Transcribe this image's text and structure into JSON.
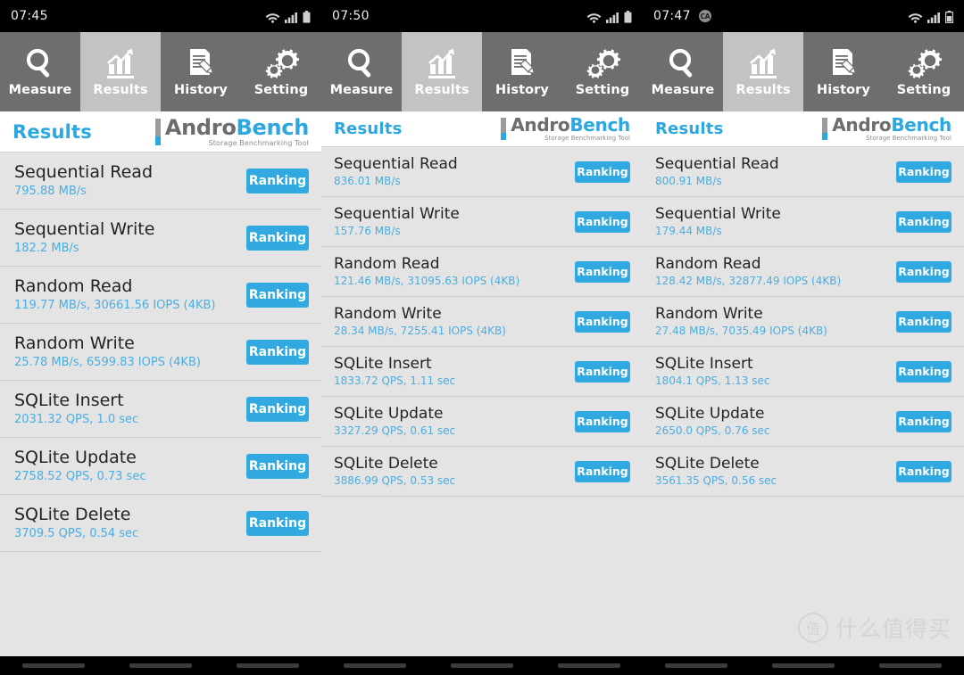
{
  "app": {
    "name": "AndroBench",
    "logo": {
      "part_a": "Andro",
      "part_b": "Bench",
      "tagline": "Storage Benchmarking Tool"
    },
    "header_title": "Results",
    "accent_color": "#30a9e0",
    "tabbar_color": "#6e6e6e",
    "tab_active_color": "#c3c3c3",
    "value_color": "#4aaee2"
  },
  "tabs": [
    {
      "id": "measure",
      "label": "Measure",
      "icon": "magnifier-icon",
      "active": false
    },
    {
      "id": "results",
      "label": "Results",
      "icon": "bar-chart-icon",
      "active": true
    },
    {
      "id": "history",
      "label": "History",
      "icon": "document-pencil-icon",
      "active": false
    },
    {
      "id": "setting",
      "label": "Setting",
      "icon": "gears-icon",
      "active": false
    }
  ],
  "ranking_label": "Ranking",
  "watermark": {
    "badge": "值",
    "text": "什么值得买"
  },
  "panels": [
    {
      "id": "panel-1",
      "status": {
        "time": "07:45",
        "badge": "",
        "icons": [
          "wifi-icon",
          "signal-icon",
          "battery-icon"
        ]
      },
      "rows": [
        {
          "title": "Sequential Read",
          "value": "795.88 MB/s"
        },
        {
          "title": "Sequential Write",
          "value": "182.2 MB/s"
        },
        {
          "title": "Random Read",
          "value": "119.77 MB/s, 30661.56 IOPS (4KB)"
        },
        {
          "title": "Random Write",
          "value": "25.78 MB/s, 6599.83 IOPS (4KB)"
        },
        {
          "title": "SQLite Insert",
          "value": "2031.32 QPS, 1.0 sec"
        },
        {
          "title": "SQLite Update",
          "value": "2758.52 QPS, 0.73 sec"
        },
        {
          "title": "SQLite Delete",
          "value": "3709.5 QPS, 0.54 sec"
        }
      ]
    },
    {
      "id": "panel-2",
      "status": {
        "time": "07:50",
        "badge": "",
        "icons": [
          "wifi-icon",
          "signal-icon",
          "battery-icon"
        ]
      },
      "rows": [
        {
          "title": "Sequential Read",
          "value": "836.01 MB/s"
        },
        {
          "title": "Sequential Write",
          "value": "157.76 MB/s"
        },
        {
          "title": "Random Read",
          "value": "121.46 MB/s, 31095.63 IOPS (4KB)"
        },
        {
          "title": "Random Write",
          "value": "28.34 MB/s, 7255.41 IOPS (4KB)"
        },
        {
          "title": "SQLite Insert",
          "value": "1833.72 QPS, 1.11 sec"
        },
        {
          "title": "SQLite Update",
          "value": "3327.29 QPS, 0.61 sec"
        },
        {
          "title": "SQLite Delete",
          "value": "3886.99 QPS, 0.53 sec"
        }
      ]
    },
    {
      "id": "panel-3",
      "status": {
        "time": "07:47",
        "badge": "CA",
        "icons": [
          "wifi-icon",
          "signal-icon",
          "battery-icon"
        ]
      },
      "rows": [
        {
          "title": "Sequential Read",
          "value": "800.91 MB/s"
        },
        {
          "title": "Sequential Write",
          "value": "179.44 MB/s"
        },
        {
          "title": "Random Read",
          "value": "128.42 MB/s, 32877.49 IOPS (4KB)"
        },
        {
          "title": "Random Write",
          "value": "27.48 MB/s, 7035.49 IOPS (4KB)"
        },
        {
          "title": "SQLite Insert",
          "value": "1804.1 QPS, 1.13 sec"
        },
        {
          "title": "SQLite Update",
          "value": "2650.0 QPS, 0.76 sec"
        },
        {
          "title": "SQLite Delete",
          "value": "3561.35 QPS, 0.56 sec"
        }
      ]
    }
  ]
}
